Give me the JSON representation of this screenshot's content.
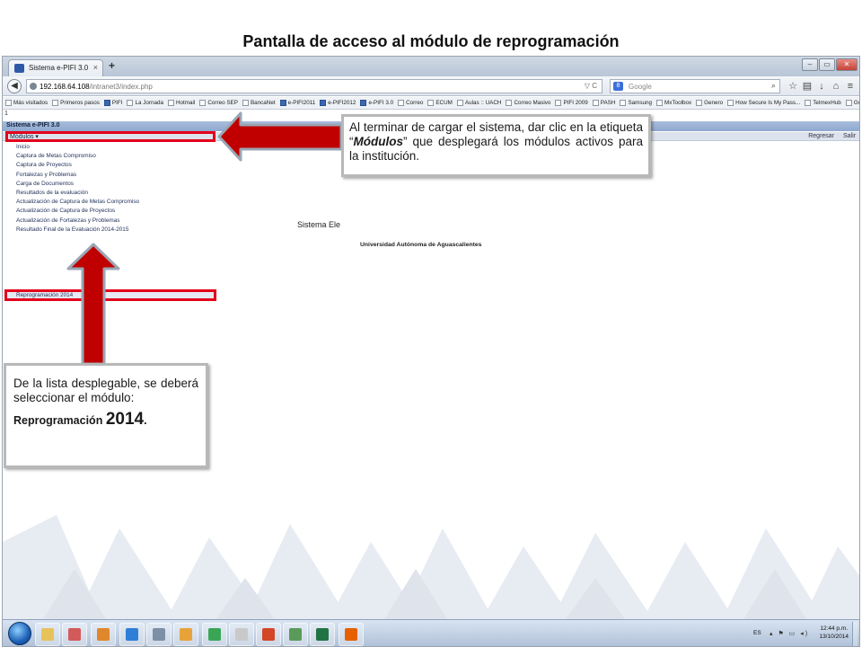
{
  "slide": {
    "title": "Pantalla de acceso al módulo de reprogramación"
  },
  "browser": {
    "tab_title": "Sistema e-PIFI 3.0",
    "tab_close": "×",
    "new_tab": "+",
    "url_host": "192.168.64.108",
    "url_path": "/intranet3/index.php",
    "url_right": "▽ C",
    "search_engine": "8",
    "search_placeholder": "Google",
    "window_buttons": [
      "–",
      "▭",
      "✕"
    ],
    "nav_icons": [
      "star-icon",
      "bookmark-icon",
      "download-icon",
      "home-icon",
      "menu-icon"
    ]
  },
  "bookmarks": [
    {
      "label": "Más visitados",
      "icon": "page"
    },
    {
      "label": "Primeros pasos",
      "icon": "page"
    },
    {
      "label": "PIFI",
      "icon": "blue"
    },
    {
      "label": "La Jornada",
      "icon": "page"
    },
    {
      "label": "Hotmail",
      "icon": "page"
    },
    {
      "label": "Correo SEP",
      "icon": "page"
    },
    {
      "label": "BancaNet",
      "icon": "page"
    },
    {
      "label": "e-PIFI2011",
      "icon": "blue"
    },
    {
      "label": "e-PIFI2012",
      "icon": "blue"
    },
    {
      "label": "e-PIFI 3.0",
      "icon": "blue"
    },
    {
      "label": "Correo",
      "icon": "page"
    },
    {
      "label": "ECUM",
      "icon": "page"
    },
    {
      "label": "Aulas :: UACH",
      "icon": "page"
    },
    {
      "label": "Correo Masivo",
      "icon": "page"
    },
    {
      "label": "PIFI 2009",
      "icon": "page"
    },
    {
      "label": "PASH",
      "icon": "page"
    },
    {
      "label": "Samsung",
      "icon": "page"
    },
    {
      "label": "MxToolbox",
      "icon": "page"
    },
    {
      "label": "Genero",
      "icon": "page"
    },
    {
      "label": "How Secure Is My Pass...",
      "icon": "page"
    },
    {
      "label": "TelmexHub",
      "icon": "page"
    },
    {
      "label": "Google",
      "icon": "page"
    },
    {
      "label": "Dell",
      "icon": "folder"
    },
    {
      "label": "HP",
      "icon": "folder"
    }
  ],
  "app": {
    "page_marker": "1",
    "header_title": "Sistema e-PIFI 3.0",
    "modules_button": "Módulos ▾",
    "top_links": [
      "Regresar",
      "Salir"
    ],
    "menu_items": [
      "Inicio",
      "Captura de Metas Compromiso",
      "Captura de Proyectos",
      "Fortalezas y Problemas",
      "Carga de Documentos",
      "Resultados de la evaluación",
      "Actualización de Captura de Metas Compromiso",
      "Actualización de Captura de Proyectos",
      "Actualización de Fortalezas y Problemas",
      "Resultado Final de la Evaluación 2014-2015"
    ],
    "selected_item": "Reprogramación 2014",
    "system_title": "Sistema Ele",
    "university": "Universidad Autónoma de Aguascalientes"
  },
  "callouts": {
    "top": {
      "before": "Al terminar de cargar el sistema, dar clic en la etiqueta “",
      "emph": "Módulos",
      "after": "” que desplegará los módulos activos para la institución."
    },
    "bottom": {
      "text": "De la lista desplegable, se deberá seleccionar el módulo:",
      "label": "Reprogramación ",
      "year": "2014",
      "period": "."
    }
  },
  "taskbar": {
    "apps": [
      {
        "name": "explorer-icon",
        "color": "#e7c25a"
      },
      {
        "name": "snipping-tool-icon",
        "color": "#d35a5a"
      },
      {
        "name": "media-player-icon",
        "color": "#e0862d"
      },
      {
        "name": "internet-explorer-icon",
        "color": "#2f7fd8"
      },
      {
        "name": "calculator-icon",
        "color": "#7d8fa6"
      },
      {
        "name": "outlook-icon",
        "color": "#e8a23a"
      },
      {
        "name": "chrome-icon",
        "color": "#3aa655"
      },
      {
        "name": "acrobat-icon",
        "color": "#c9c9c9"
      },
      {
        "name": "powerpoint-icon",
        "color": "#d24726"
      },
      {
        "name": "notepad-icon",
        "color": "#5a9b5a"
      },
      {
        "name": "excel-icon",
        "color": "#217346"
      },
      {
        "name": "firefox-icon",
        "color": "#e66000"
      }
    ],
    "lang": "ES",
    "tray_icons": "▴ ⚑ ▭ ◂)",
    "time": "12:44 p.m.",
    "date": "13/10/2014"
  },
  "colors": {
    "highlight_red": "#e3001b",
    "arrow_red": "#c00000",
    "app_header": "#8ea8cf"
  }
}
